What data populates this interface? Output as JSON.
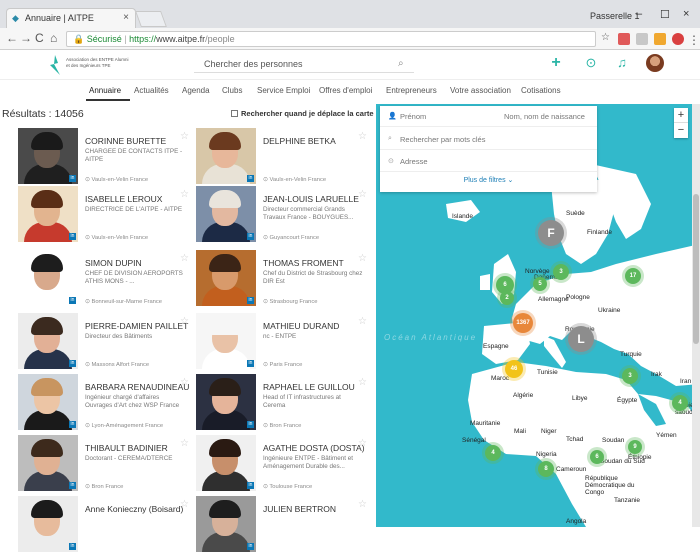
{
  "browser": {
    "tab_title": "Annuaire | AITPE",
    "tab_close": "×",
    "user": "Passerelle 1",
    "secure_label": "Sécurisé",
    "url_proto": "https://",
    "url_host": "www.aitpe.fr",
    "url_path": "/people",
    "back": "←",
    "forward": "→",
    "reload": "C",
    "home": "⌂",
    "minimize": "–",
    "maximize": "☐",
    "close": "×"
  },
  "site": {
    "logo_line1": "Association des ENTPE Alumni",
    "logo_line2": "et des Ingénieurs TPE",
    "search_placeholder": "Chercher des personnes"
  },
  "nav": {
    "items": [
      "Annuaire",
      "Actualités",
      "Agenda",
      "Clubs",
      "Service Emploi",
      "Offres d'emploi",
      "Entrepreneurs",
      "Votre association",
      "Cotisations"
    ]
  },
  "list": {
    "results_label": "Résultats : 14056",
    "map_toggle_label": "Rechercher quand je déplace la carte",
    "cards": [
      {
        "name": "CORINNE BURETTE",
        "sub": "CHARGEE DE CONTACTS ITPE - AITPE",
        "loc": "Vaulx-en-Velin France"
      },
      {
        "name": "DELPHINE BETKA",
        "sub": "",
        "loc": "Vaulx-en-Velin France"
      },
      {
        "name": "ISABELLE LEROUX",
        "sub": "DIRECTRICE DE L'AITPE - AITPE",
        "loc": "Vaulx-en-Velin France"
      },
      {
        "name": "JEAN-LOUIS LARUELLE",
        "sub": "Directeur commercial Grands Travaux France - BOUYGUES...",
        "loc": "Guyancourt France"
      },
      {
        "name": "SIMON DUPIN",
        "sub": "CHEF DE DIVISION AEROPORTS ATHIS MONS - ...",
        "loc": "Bonneuil-sur-Marne France"
      },
      {
        "name": "THOMAS FROMENT",
        "sub": "Chef du District de Strasbourg chez DIR Est",
        "loc": "Strasbourg France"
      },
      {
        "name": "PIERRE-DAMIEN PAILLET",
        "sub": "Directeur des Bâtiments",
        "loc": "Massons Alfort France"
      },
      {
        "name": "MATHIEU DURAND",
        "sub": "nc - ENTPE",
        "loc": "Paris France"
      },
      {
        "name": "BARBARA RENAUDINEAU",
        "sub": "Ingénieur chargé d'affaires Ouvrages d'Art chez WSP France",
        "loc": "Lyon-Aménagement France"
      },
      {
        "name": "RAPHAEL LE GUILLOU",
        "sub": "Head of IT infrastructures at Cerema",
        "loc": "Bron France"
      },
      {
        "name": "THIBAULT BADINIER",
        "sub": "Doctorant - CEREMA/DTERCE",
        "loc": "Bron France"
      },
      {
        "name": "AGATHE DOSTA (DOSTA)",
        "sub": "Ingénieure ENTPE - Bâtiment et Aménagement Durable des...",
        "loc": "Toulouse France"
      },
      {
        "name": "Anne Konieczny (Boisard)",
        "sub": "",
        "loc": ""
      },
      {
        "name": "JULIEN BERTRON",
        "sub": "",
        "loc": ""
      }
    ]
  },
  "filters": {
    "first_name": "Prénom",
    "last_name": "Nom, nom de naissance",
    "keywords": "Rechercher par mots clés",
    "address": "Adresse",
    "more": "Plus de filtres"
  },
  "map": {
    "zoom_in": "+",
    "zoom_out": "−",
    "labels": [
      "Islande",
      "Suède",
      "Finlande",
      "Norvège",
      "Danemark",
      "Allemagne",
      "Pologne",
      "Ukraine",
      "Roumanie",
      "Espagne",
      "Turquie",
      "Irak",
      "Iran",
      "Maroc",
      "Tunisie",
      "Algérie",
      "Libye",
      "Égypte",
      "Arabie saoudite",
      "Mauritanie",
      "Mali",
      "Niger",
      "Tchad",
      "Soudan",
      "Yémen",
      "Sénégal",
      "Nigeria",
      "Cameroun",
      "Soudan du Sud",
      "Éthiopie",
      "République Démocratique du Congo",
      "Tanzanie",
      "Angola"
    ],
    "clusters": [
      {
        "label": "F",
        "color": "#8d8d8d"
      },
      {
        "label": "L",
        "color": "#8d8d8d"
      },
      {
        "label": "46",
        "color": "#f2c319"
      },
      {
        "label": "1367",
        "color": "#e8873a"
      },
      {
        "label": "6",
        "color": "#5cb85c"
      },
      {
        "label": "3",
        "color": "#5cb85c"
      },
      {
        "label": "17",
        "color": "#5cb85c"
      },
      {
        "label": "2",
        "color": "#5cb85c"
      },
      {
        "label": "5",
        "color": "#5cb85c"
      },
      {
        "label": "4",
        "color": "#5cb85c"
      },
      {
        "label": "8",
        "color": "#5cb85c"
      },
      {
        "label": "9",
        "color": "#5cb85c"
      },
      {
        "label": "6",
        "color": "#5cb85c"
      },
      {
        "label": "3",
        "color": "#5cb85c"
      },
      {
        "label": "4",
        "color": "#5cb85c"
      }
    ],
    "ocean_text": "Océan Atlantique"
  },
  "colors": {
    "accent": "#2bb5a6",
    "map_water": "#32b9cb",
    "map_land": "#ffffff",
    "cluster_green": "#5cb85c",
    "cluster_yellow": "#f2c319",
    "link_blue": "#1e7fb6"
  }
}
